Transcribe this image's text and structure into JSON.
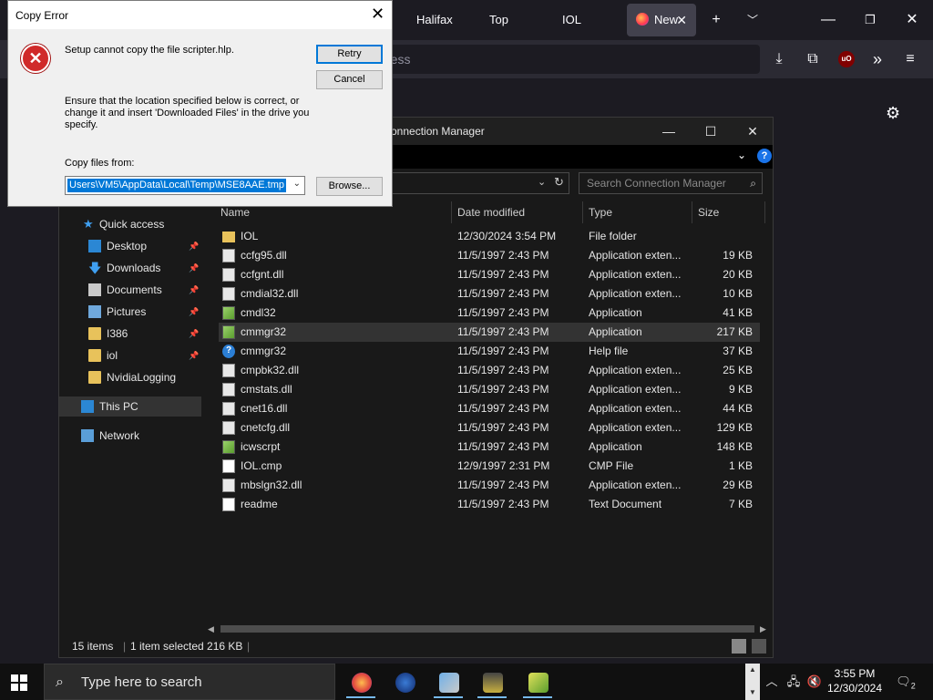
{
  "firefox": {
    "tabs": [
      "Halifax",
      "Top",
      "IOL"
    ],
    "active_tab": "New",
    "urlbar_text": "ress"
  },
  "explorer": {
    "title": "onnection Manager",
    "search_placeholder": "Search Connection Manager",
    "nav": {
      "quick_access": "Quick access",
      "items": [
        "Desktop",
        "Downloads",
        "Documents",
        "Pictures",
        "I386",
        "iol",
        "NvidiaLogging"
      ],
      "this_pc": "This PC",
      "network": "Network"
    },
    "columns": {
      "name": "Name",
      "date": "Date modified",
      "type": "Type",
      "size": "Size"
    },
    "files": [
      {
        "name": "IOL",
        "date": "12/30/2024 3:54 PM",
        "type": "File folder",
        "size": "",
        "kind": "folder"
      },
      {
        "name": "ccfg95.dll",
        "date": "11/5/1997 2:43 PM",
        "type": "Application exten...",
        "size": "19 KB",
        "kind": "dll"
      },
      {
        "name": "ccfgnt.dll",
        "date": "11/5/1997 2:43 PM",
        "type": "Application exten...",
        "size": "20 KB",
        "kind": "dll"
      },
      {
        "name": "cmdial32.dll",
        "date": "11/5/1997 2:43 PM",
        "type": "Application exten...",
        "size": "10 KB",
        "kind": "dll"
      },
      {
        "name": "cmdl32",
        "date": "11/5/1997 2:43 PM",
        "type": "Application",
        "size": "41 KB",
        "kind": "app"
      },
      {
        "name": "cmmgr32",
        "date": "11/5/1997 2:43 PM",
        "type": "Application",
        "size": "217 KB",
        "kind": "app"
      },
      {
        "name": "cmmgr32",
        "date": "11/5/1997 2:43 PM",
        "type": "Help file",
        "size": "37 KB",
        "kind": "help"
      },
      {
        "name": "cmpbk32.dll",
        "date": "11/5/1997 2:43 PM",
        "type": "Application exten...",
        "size": "25 KB",
        "kind": "dll"
      },
      {
        "name": "cmstats.dll",
        "date": "11/5/1997 2:43 PM",
        "type": "Application exten...",
        "size": "9 KB",
        "kind": "dll"
      },
      {
        "name": "cnet16.dll",
        "date": "11/5/1997 2:43 PM",
        "type": "Application exten...",
        "size": "44 KB",
        "kind": "dll"
      },
      {
        "name": "cnetcfg.dll",
        "date": "11/5/1997 2:43 PM",
        "type": "Application exten...",
        "size": "129 KB",
        "kind": "dll"
      },
      {
        "name": "icwscrpt",
        "date": "11/5/1997 2:43 PM",
        "type": "Application",
        "size": "148 KB",
        "kind": "app"
      },
      {
        "name": "IOL.cmp",
        "date": "12/9/1997 2:31 PM",
        "type": "CMP File",
        "size": "1 KB",
        "kind": "doc"
      },
      {
        "name": "mbslgn32.dll",
        "date": "11/5/1997 2:43 PM",
        "type": "Application exten...",
        "size": "29 KB",
        "kind": "dll"
      },
      {
        "name": "readme",
        "date": "11/5/1997 2:43 PM",
        "type": "Text Document",
        "size": "7 KB",
        "kind": "doc"
      }
    ],
    "status": {
      "count": "15 items",
      "selected": "1 item selected  216 KB"
    }
  },
  "dialog": {
    "title": "Copy Error",
    "message": "Setup cannot copy the file scripter.hlp.",
    "instructions": [
      "Ensure that the location specified below is correct, or",
      "change it and insert 'Downloaded Files' in the drive you",
      "specify."
    ],
    "copy_from_label": "Copy files from:",
    "copy_from_value": "Users\\VM5\\AppData\\Local\\Temp\\MSE8AAE.tmp",
    "retry": "Retry",
    "cancel": "Cancel",
    "browse": "Browse..."
  },
  "taskbar": {
    "search_placeholder": "Type here to search",
    "time": "3:55 PM",
    "date": "12/30/2024",
    "notifications": "2"
  }
}
